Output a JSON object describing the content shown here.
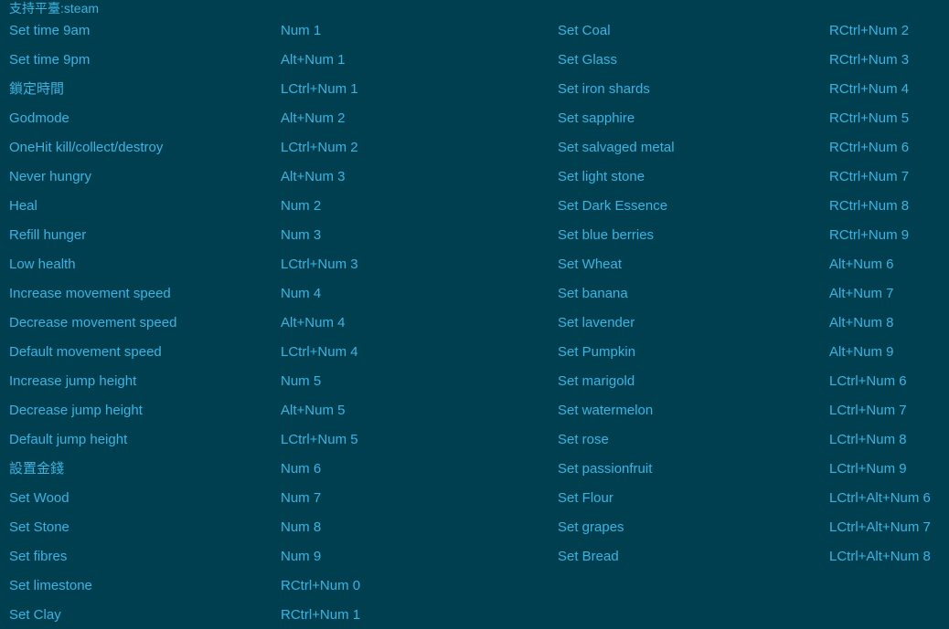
{
  "header": "支持平臺:steam",
  "left_column": [
    {
      "name": "Set time 9am",
      "key": "Num 1"
    },
    {
      "name": "Set time 9pm",
      "key": "Alt+Num 1"
    },
    {
      "name": "鎖定時間",
      "key": "LCtrl+Num 1"
    },
    {
      "name": "Godmode",
      "key": "Alt+Num 2"
    },
    {
      "name": "OneHit kill/collect/destroy",
      "key": "LCtrl+Num 2"
    },
    {
      "name": "Never hungry",
      "key": "Alt+Num 3"
    },
    {
      "name": "Heal",
      "key": "Num 2"
    },
    {
      "name": "Refill hunger",
      "key": "Num 3"
    },
    {
      "name": "Low health",
      "key": "LCtrl+Num 3"
    },
    {
      "name": "Increase movement speed",
      "key": "Num 4"
    },
    {
      "name": "Decrease movement speed",
      "key": "Alt+Num 4"
    },
    {
      "name": "Default movement speed",
      "key": "LCtrl+Num 4"
    },
    {
      "name": "Increase jump height",
      "key": "Num 5"
    },
    {
      "name": "Decrease jump height",
      "key": "Alt+Num 5"
    },
    {
      "name": "Default jump height",
      "key": "LCtrl+Num 5"
    },
    {
      "name": "設置金錢",
      "key": "Num 6"
    },
    {
      "name": "Set Wood",
      "key": "Num 7"
    },
    {
      "name": "Set Stone",
      "key": "Num 8"
    },
    {
      "name": "Set fibres",
      "key": "Num 9"
    },
    {
      "name": "Set limestone",
      "key": "RCtrl+Num 0"
    },
    {
      "name": "Set Clay",
      "key": "RCtrl+Num 1"
    }
  ],
  "right_column": [
    {
      "name": "Set Coal",
      "key": "RCtrl+Num 2"
    },
    {
      "name": "Set Glass",
      "key": "RCtrl+Num 3"
    },
    {
      "name": "Set iron shards",
      "key": "RCtrl+Num 4"
    },
    {
      "name": "Set sapphire",
      "key": "RCtrl+Num 5"
    },
    {
      "name": "Set salvaged metal",
      "key": "RCtrl+Num 6"
    },
    {
      "name": "Set light stone",
      "key": "RCtrl+Num 7"
    },
    {
      "name": "Set Dark Essence",
      "key": "RCtrl+Num 8"
    },
    {
      "name": "Set blue berries",
      "key": "RCtrl+Num 9"
    },
    {
      "name": "Set Wheat",
      "key": "Alt+Num 6"
    },
    {
      "name": "Set banana",
      "key": "Alt+Num 7"
    },
    {
      "name": "Set lavender",
      "key": "Alt+Num 8"
    },
    {
      "name": "Set Pumpkin",
      "key": "Alt+Num 9"
    },
    {
      "name": "Set marigold",
      "key": "LCtrl+Num 6"
    },
    {
      "name": "Set watermelon",
      "key": "LCtrl+Num 7"
    },
    {
      "name": "Set rose",
      "key": "LCtrl+Num 8"
    },
    {
      "name": "Set passionfruit",
      "key": "LCtrl+Num 9"
    },
    {
      "name": "Set Flour",
      "key": "LCtrl+Alt+Num 6"
    },
    {
      "name": "Set grapes",
      "key": "LCtrl+Alt+Num 7"
    },
    {
      "name": "Set Bread",
      "key": "LCtrl+Alt+Num 8"
    }
  ],
  "colors": {
    "background": "#003f4f",
    "text": "#3fb3e2"
  }
}
